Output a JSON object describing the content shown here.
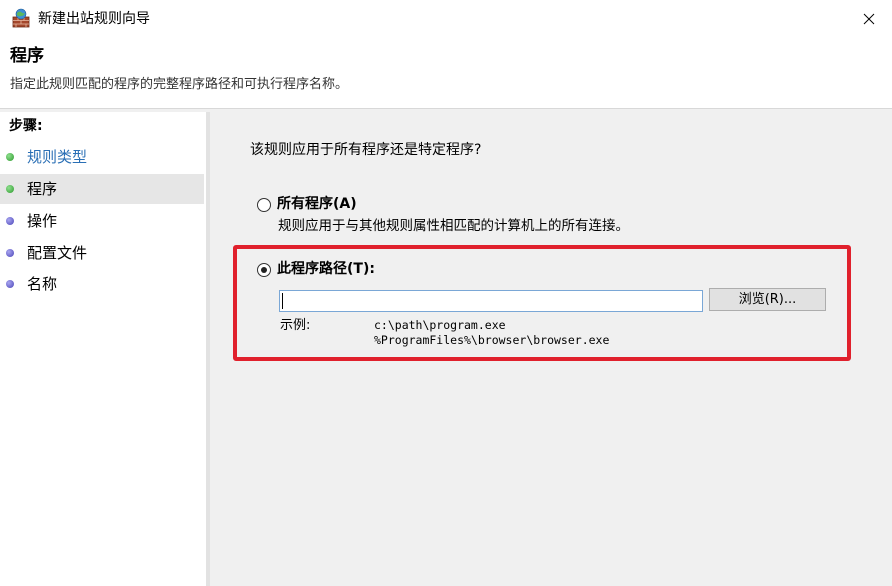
{
  "window": {
    "title": "新建出站规则向导",
    "close_glyph": "✕"
  },
  "header": {
    "title": "程序",
    "subtitle": "指定此规则匹配的程序的完整程序路径和可执行程序名称。"
  },
  "sidebar": {
    "heading": "步骤:",
    "items": [
      {
        "label": "规则类型",
        "color": "#2a6fb5",
        "dot_color": "#3cae3c",
        "active": false
      },
      {
        "label": "程序",
        "color": "#000000",
        "dot_color": "#3cae3c",
        "active": true
      },
      {
        "label": "操作",
        "color": "#000000",
        "dot_color": "#5a55c8",
        "active": false
      },
      {
        "label": "配置文件",
        "color": "#000000",
        "dot_color": "#5a55c8",
        "active": false
      },
      {
        "label": "名称",
        "color": "#000000",
        "dot_color": "#5a55c8",
        "active": false
      }
    ]
  },
  "content": {
    "question": "该规则应用于所有程序还是特定程序?",
    "options": [
      {
        "label": "所有程序(A)",
        "description": "规则应用于与其他规则属性相匹配的计算机上的所有连接。",
        "selected": false
      },
      {
        "label": "此程序路径(T):",
        "selected": true
      }
    ],
    "path_input_value": "",
    "browse_label": "浏览(R)...",
    "example_label": "示例:",
    "examples": [
      "c:\\path\\program.exe",
      "%ProgramFiles%\\browser\\browser.exe"
    ]
  },
  "colors": {
    "highlight_border": "#e0202c",
    "input_border": "#7aa7d6"
  }
}
